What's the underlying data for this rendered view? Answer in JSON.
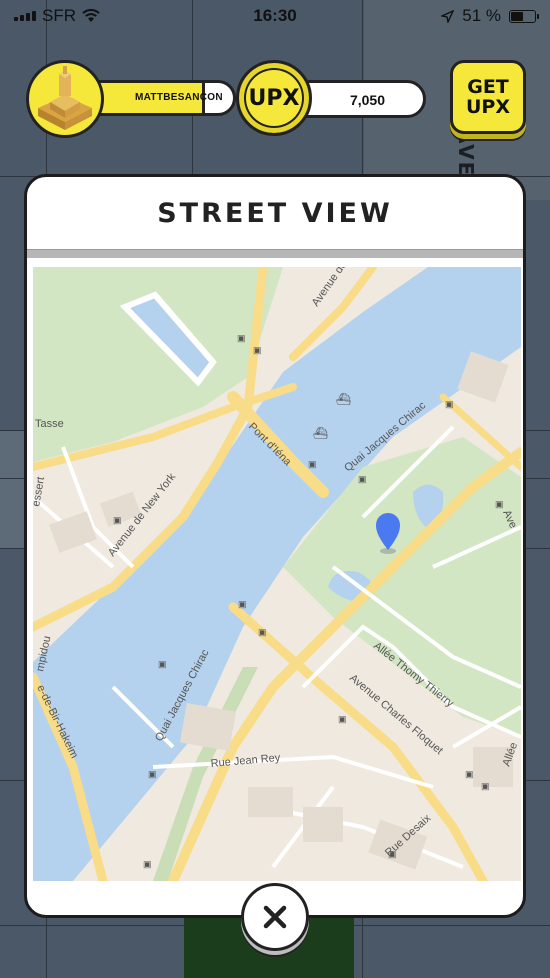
{
  "status_bar": {
    "carrier": "SFR",
    "time": "16:30",
    "battery": "51 %"
  },
  "background": {
    "street_label": "AVE"
  },
  "profile": {
    "username": "MATTBESANCON"
  },
  "currency": {
    "coin_label": "UPX",
    "amount": "7,050"
  },
  "get_upx": {
    "line1": "GET",
    "line2": "UPX"
  },
  "modal": {
    "title": "STREET VIEW",
    "close_label": "×"
  },
  "map": {
    "labels": {
      "avenue_new_york": "Avenue de New York",
      "pont_iena": "Pont d'Iéna",
      "quai_chirac_top": "Quai Jacques Chirac",
      "quai_chirac_bottom": "Quai Jacques Chirac",
      "rue_jean_rey": "Rue Jean Rey",
      "allee_thomy_thierry": "Allée Thomy Thierry",
      "avenue_charles_floquet": "Avenue Charles Floquet",
      "rue_desaix": "Rue Desaix",
      "avenue_top": "Avenue de",
      "tasse": "Tasse",
      "essert": "essert",
      "mpidou": "mpidou",
      "bir_hakeim": "e-de-Bir-Hakeim",
      "ave_right": "Ave",
      "allee_right": "Allée"
    },
    "colors": {
      "water": "#b4d2ee",
      "park": "#d3e6c3",
      "major_road": "#f9dc88",
      "land": "#efe9df",
      "pin": "#4a79f0"
    }
  }
}
